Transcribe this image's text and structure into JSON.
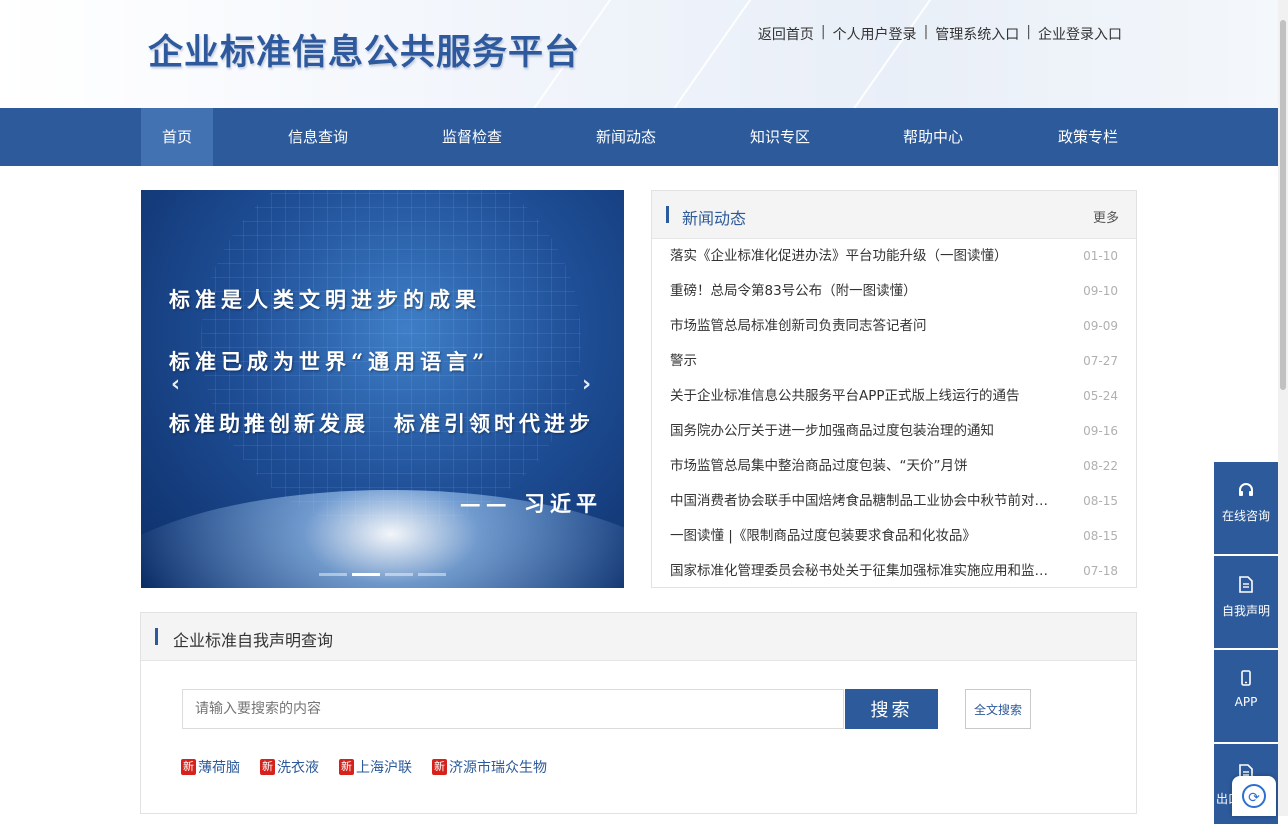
{
  "header": {
    "site_title": "企业标准信息公共服务平台",
    "links": [
      "返回首页",
      "个人用户登录",
      "管理系统入口",
      "企业登录入口"
    ],
    "separator": "|"
  },
  "nav": {
    "items": [
      "首页",
      "信息查询",
      "监督检查",
      "新闻动态",
      "知识专区",
      "帮助中心",
      "政策专栏"
    ],
    "active": "首页"
  },
  "banner": {
    "lines": [
      "标准是人类文明进步的成果",
      "标准已成为世界“通用语言”",
      "标准助推创新发展　标准引领时代进步"
    ],
    "author": "—— 习近平",
    "prev_arrow": "‹",
    "next_arrow": "›",
    "slide_count": 4,
    "active_slide": 2
  },
  "news": {
    "title": "新闻动态",
    "more": "更多",
    "items": [
      {
        "title": "落实《企业标准化促进办法》平台功能升级（一图读懂）",
        "date": "01-10"
      },
      {
        "title": "重磅！总局令第83号公布（附一图读懂）",
        "date": "09-10"
      },
      {
        "title": "市场监管总局标准创新司负责同志答记者问",
        "date": "09-09"
      },
      {
        "title": "警示",
        "date": "07-27"
      },
      {
        "title": "关于企业标准信息公共服务平台APP正式版上线运行的通告",
        "date": "05-24"
      },
      {
        "title": "国务院办公厅关于进一步加强商品过度包装治理的通知",
        "date": "09-16"
      },
      {
        "title": "市场监管总局集中整治商品过度包装、“天价”月饼",
        "date": "08-22"
      },
      {
        "title": "中国消费者协会联手中国焙烤食品糖制品工业协会中秋节前对月...",
        "date": "08-15"
      },
      {
        "title": "一图读懂 |《限制商品过度包装要求食品和化妆品》",
        "date": "08-15"
      },
      {
        "title": "国家标准化管理委员会秘书处关于征集加强标准实施应用和监督...",
        "date": "07-18"
      }
    ]
  },
  "query": {
    "title": "企业标准自我声明查询",
    "placeholder": "请输入要搜索的内容",
    "search_button": "搜索",
    "fulltext_button": "全文搜索",
    "badge": "新",
    "tags": [
      "薄荷脑",
      "洗衣液",
      "上海沪联",
      "济源市瑞众生物"
    ]
  },
  "float_bar": {
    "items": [
      {
        "label": "在线咨询",
        "icon": "headset-icon"
      },
      {
        "label": "自我声明",
        "icon": "document-icon"
      },
      {
        "label": "APP",
        "icon": "phone-icon"
      },
      {
        "label": "出口",
        "icon": "document-icon"
      }
    ]
  }
}
